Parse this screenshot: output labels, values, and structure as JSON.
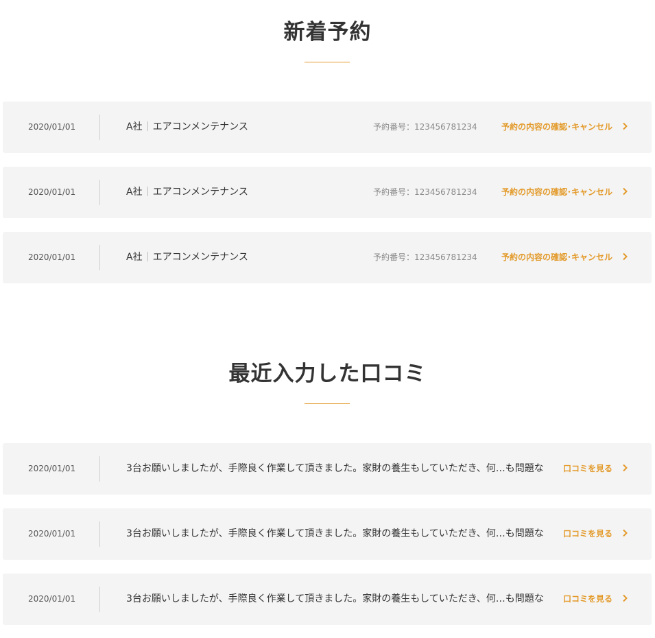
{
  "reservations": {
    "title": "新着予約",
    "items": [
      {
        "date": "2020/01/01",
        "company": "A社",
        "service": "エアコンメンテナンス",
        "number": "予約番号：123456781234",
        "action": "予約の内容の確認･キャンセル"
      },
      {
        "date": "2020/01/01",
        "company": "A社",
        "service": "エアコンメンテナンス",
        "number": "予約番号：123456781234",
        "action": "予約の内容の確認･キャンセル"
      },
      {
        "date": "2020/01/01",
        "company": "A社",
        "service": "エアコンメンテナンス",
        "number": "予約番号：123456781234",
        "action": "予約の内容の確認･キャンセル"
      }
    ]
  },
  "reviews": {
    "title": "最近入力した口コミ",
    "items": [
      {
        "date": "2020/01/01",
        "text": "3台お願いしましたが、手際良く作業して頂きました。家財の養生もしていただき、何…も問題な…く終え",
        "action": "口コミを見る"
      },
      {
        "date": "2020/01/01",
        "text": "3台お願いしましたが、手際良く作業して頂きました。家財の養生もしていただき、何…も問題な…く終え",
        "action": "口コミを見る"
      },
      {
        "date": "2020/01/01",
        "text": "3台お願いしましたが、手際良く作業して頂きました。家財の養生もしていただき、何…も問題な…く終え",
        "action": "口コミを見る"
      }
    ]
  },
  "colors": {
    "accent": "#e39a2a",
    "row_background": "#f4f4f4",
    "text": "#333333"
  },
  "icons": {
    "action_arrow": "chevron-right-icon"
  }
}
